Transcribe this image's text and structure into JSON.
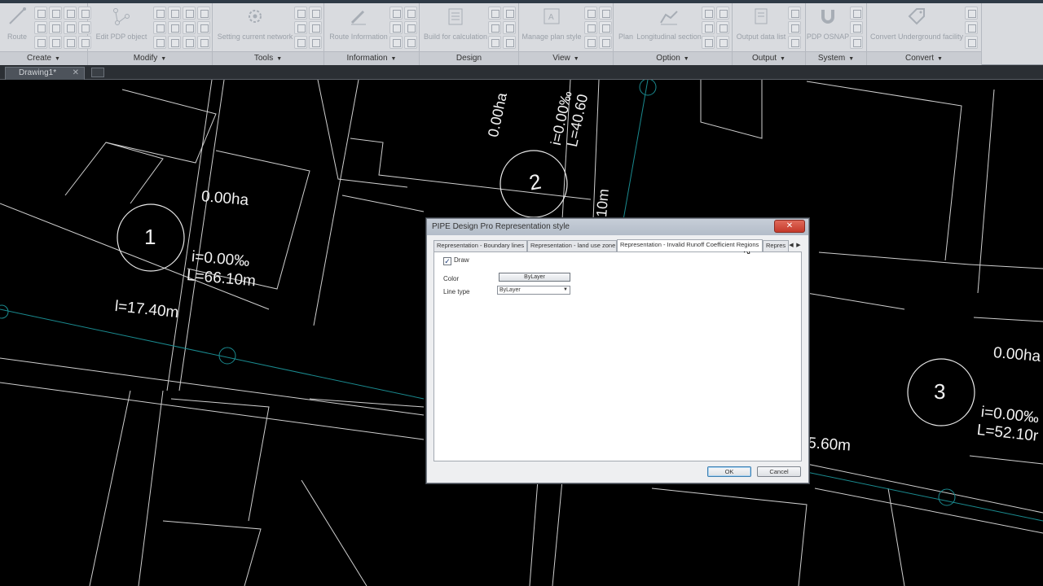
{
  "ribbon": {
    "panels": [
      {
        "title": "Create",
        "buttons": [
          "Route"
        ]
      },
      {
        "title": "Modify",
        "buttons": [
          "Edit PDP object"
        ]
      },
      {
        "title": "Tools",
        "buttons": [
          "Setting current network"
        ]
      },
      {
        "title": "Information",
        "buttons": [
          "Route Information"
        ]
      },
      {
        "title": "Design",
        "buttons": [
          "Build for calculation"
        ]
      },
      {
        "title": "View",
        "buttons": [
          "Manage plan style"
        ]
      },
      {
        "title": "Option",
        "buttons": [
          "Plan",
          "Longitudinal section"
        ]
      },
      {
        "title": "Output",
        "buttons": [
          "Output data list"
        ]
      },
      {
        "title": "System",
        "buttons": [
          "PDP OSNAP"
        ]
      },
      {
        "title": "Convert",
        "buttons": [
          "Convert Underground facility"
        ]
      }
    ]
  },
  "document_tab": {
    "label": "Drawing1*"
  },
  "drawing": {
    "nodes": [
      "1",
      "2",
      "3"
    ],
    "area_1": "0.00ha",
    "slope_1": "i=0.00‰",
    "length_1": "L=66.10m",
    "area_2": "0.00ha",
    "slope_2": "i=0.00‰",
    "length_2": "L=40.60",
    "area_3": "0.00ha",
    "slope_3": "i=0.00‰",
    "length_3": "L=52.10r",
    "pipe_len_a": "l=17.40m",
    "pipe_len_b": "10m",
    "pipe_len_c": "5.60m"
  },
  "dialog": {
    "title": "PIPE Design Pro Representation style",
    "close_label": "✕",
    "tabs": [
      "Representation - Boundary lines",
      "Representation - land use zone",
      "Representation - Invalid Runoff Coefficient Regions",
      "Repres"
    ],
    "active_tab": 2,
    "draw_checkbox": {
      "label": "Draw",
      "checked": true
    },
    "color": {
      "label": "Color",
      "value": "ByLayer"
    },
    "line_type": {
      "label": "Line type",
      "value": "ByLayer"
    },
    "ok_label": "OK",
    "cancel_label": "Cancel"
  },
  "colors": {
    "canvas_bg": "#000000",
    "cad_lines": "#d8d8d8",
    "pipe_lines": "#1a8a8f",
    "ribbon_bg": "#d9dbdf"
  }
}
